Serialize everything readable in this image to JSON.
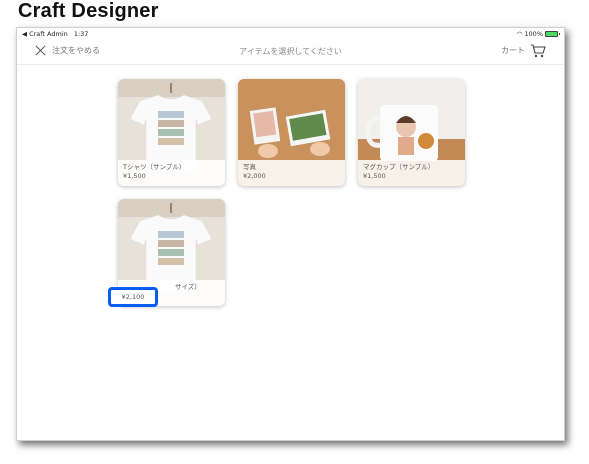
{
  "doc_title": "Craft Designer",
  "status": {
    "back_app": "◀ Craft Admin",
    "time": "1:37",
    "battery": "100%"
  },
  "nav": {
    "cancel_label": "注文をやめる",
    "title": "アイテムを選択してください",
    "cart_label": "カート"
  },
  "products": [
    {
      "name": "Tシャツ（サンプル）",
      "price": "¥1,500"
    },
    {
      "name": "写真",
      "price": "¥2,000"
    },
    {
      "name": "マグカップ（サンプル）",
      "price": "¥1,500"
    },
    {
      "name": "サイズ）",
      "price": "¥2,100"
    }
  ],
  "colors": {
    "highlight": "#0a5cf0",
    "battery": "#4cd964"
  }
}
